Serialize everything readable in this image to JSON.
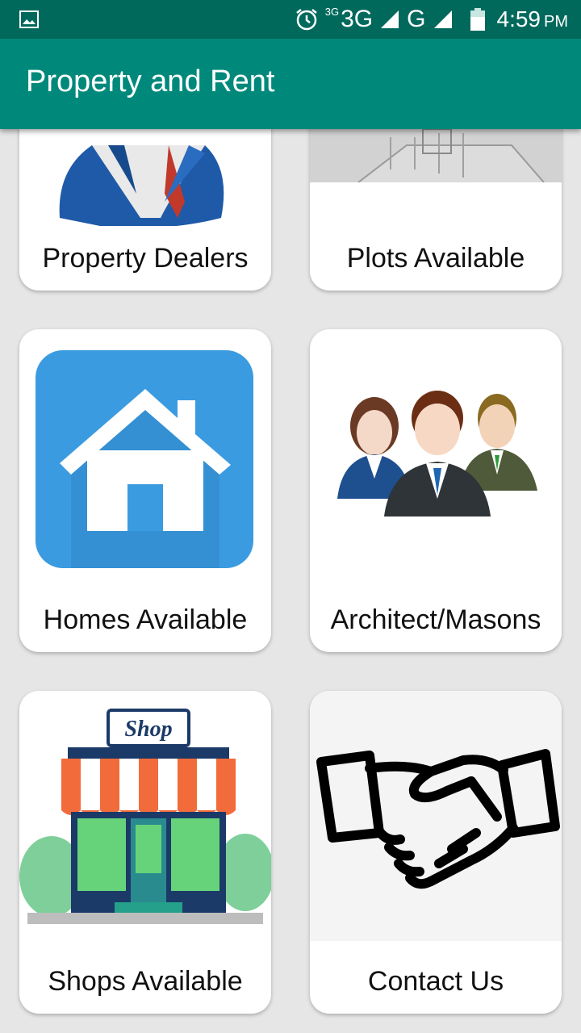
{
  "status_bar": {
    "network_small": "3G",
    "network": "3G",
    "network2": "G",
    "time": "4:59",
    "ampm": "PM",
    "icons": [
      "gallery-icon",
      "alarm-icon",
      "signal-icon",
      "signal-icon",
      "battery-icon"
    ]
  },
  "app_bar": {
    "title": "Property and Rent"
  },
  "cards": [
    {
      "label": "Property Dealers",
      "icon": "dealer-person-icon"
    },
    {
      "label": "Plots Available",
      "icon": "plot-building-icon"
    },
    {
      "label": "Homes Available",
      "icon": "house-icon"
    },
    {
      "label": "Architect/Masons",
      "icon": "people-group-icon"
    },
    {
      "label": "Shops Available",
      "icon": "shop-icon"
    },
    {
      "label": "Contact Us",
      "icon": "handshake-icon"
    }
  ]
}
